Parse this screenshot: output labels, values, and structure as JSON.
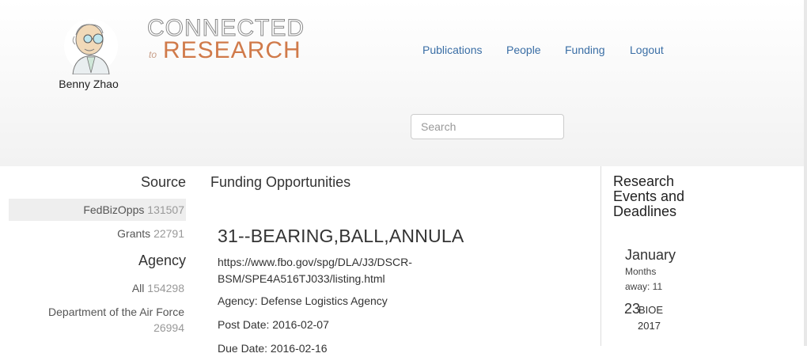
{
  "user": {
    "name": "Benny Zhao"
  },
  "logo": {
    "top": "CONNECTED",
    "to": "to",
    "bottom": "RESEARCH"
  },
  "nav": {
    "publications": "Publications",
    "people": "People",
    "funding": "Funding",
    "logout": "Logout"
  },
  "search": {
    "placeholder": "Search"
  },
  "sidebar": {
    "source_heading": "Source",
    "sources": [
      {
        "label": "FedBizOpps",
        "count": "131507",
        "active": true
      },
      {
        "label": "Grants",
        "count": "22791",
        "active": false
      }
    ],
    "agency_heading": "Agency",
    "agencies": [
      {
        "label": "All",
        "count": "154298"
      },
      {
        "label": "Department of the Air Force",
        "count": "26994"
      }
    ]
  },
  "main": {
    "title": "Funding Opportunities",
    "opportunity": {
      "title": "31--BEARING,BALL,ANNULA",
      "url_line1": "https://www.fbo.gov/spg/DLA/J3/DSCR-",
      "url_line2": "BSM/SPE4A516TJ033/listing.html",
      "agency": "Agency: Defense Logistics Agency",
      "post_date": "Post Date: 2016-02-07",
      "due_date": "Due Date: 2016-02-16"
    }
  },
  "events": {
    "title": "Research Events and Deadlines",
    "month": "January",
    "months_away": "Months away: 11",
    "day": "23",
    "tag": "BIOE",
    "year": "2017"
  }
}
